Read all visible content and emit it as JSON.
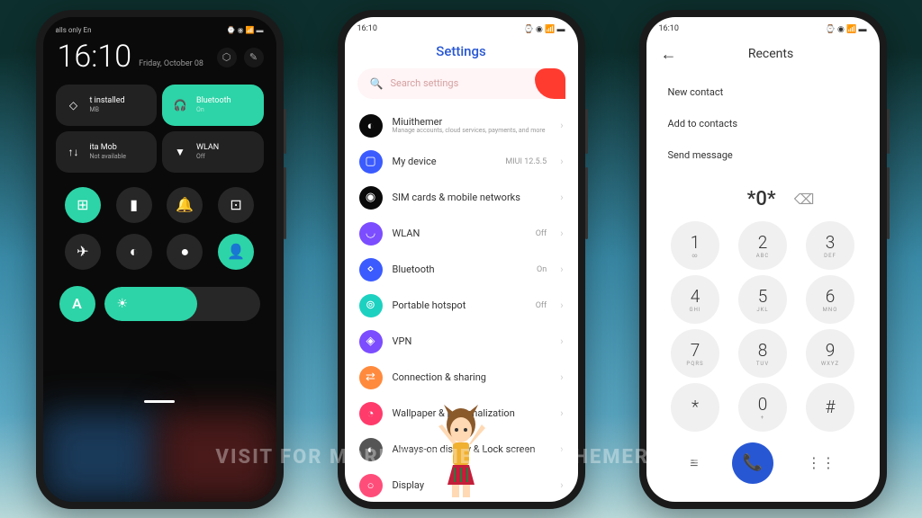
{
  "watermark": "VISIT FOR MORE THEMES - MIUITHEMER.COM",
  "p1": {
    "status_left": "alls only     En",
    "status_right": "⌚ ◉ 📶 ▬",
    "time": "16:10",
    "date": "Friday, October 08",
    "tiles": [
      {
        "title": "t installed",
        "sub": "MB",
        "icon": "◇",
        "on": false
      },
      {
        "title": "Bluetooth",
        "sub": "On",
        "icon": "🎧",
        "on": true
      },
      {
        "title": "ita    Mob",
        "sub": "Not available",
        "icon": "↑↓",
        "on": false
      },
      {
        "title": "WLAN",
        "sub": "Off",
        "icon": "▼",
        "on": false
      }
    ],
    "circles": [
      {
        "icon": "⊞",
        "on": true
      },
      {
        "icon": "▮",
        "on": false
      },
      {
        "icon": "🔔",
        "on": false
      },
      {
        "icon": "⊡",
        "on": false
      },
      {
        "icon": "✈",
        "on": false
      },
      {
        "icon": "◐",
        "on": false
      },
      {
        "icon": "●",
        "on": false
      },
      {
        "icon": "👤",
        "on": true
      }
    ],
    "auto_label": "A",
    "brightness_icon": "☀"
  },
  "p2": {
    "status_time": "16:10",
    "status_right": "⌚ ◉ 📶 ▬",
    "title": "Settings",
    "search_placeholder": "Search settings",
    "items": [
      {
        "label": "Miuithemer",
        "sub": "Manage accounts, cloud services, payments, and more",
        "val": "",
        "cls": "ic-dark",
        "icon": "◐"
      },
      {
        "label": "My device",
        "sub": "",
        "val": "MIUI 12.5.5",
        "cls": "ic-blue",
        "icon": "▢"
      },
      {
        "label": "SIM cards & mobile networks",
        "sub": "",
        "val": "",
        "cls": "ic-dark",
        "icon": "◉"
      },
      {
        "label": "WLAN",
        "sub": "",
        "val": "Off",
        "cls": "ic-purple",
        "icon": "◡"
      },
      {
        "label": "Bluetooth",
        "sub": "",
        "val": "On",
        "cls": "ic-blue",
        "icon": "⋄"
      },
      {
        "label": "Portable hotspot",
        "sub": "",
        "val": "Off",
        "cls": "ic-cyan",
        "icon": "⊚"
      },
      {
        "label": "VPN",
        "sub": "",
        "val": "",
        "cls": "ic-purple",
        "icon": "◈"
      },
      {
        "label": "Connection & sharing",
        "sub": "",
        "val": "",
        "cls": "ic-orange",
        "icon": "⇄"
      },
      {
        "label": "Wallpaper & personalization",
        "sub": "",
        "val": "",
        "cls": "ic-red",
        "icon": "◔"
      },
      {
        "label": "Always-on display & Lock screen",
        "sub": "",
        "val": "",
        "cls": "ic-gray",
        "icon": "◐"
      },
      {
        "label": "Display",
        "sub": "",
        "val": "",
        "cls": "ic-pink",
        "icon": "○"
      }
    ]
  },
  "p3": {
    "status_time": "16:10",
    "status_right": "⌚ ◉ 📶 ▬",
    "title": "Recents",
    "back": "←",
    "actions": [
      "New contact",
      "Add to contacts",
      "Send message"
    ],
    "number": "*0*",
    "del_icon": "⌫",
    "keys": [
      {
        "n": "1",
        "l": "∞"
      },
      {
        "n": "2",
        "l": "ABC"
      },
      {
        "n": "3",
        "l": "DEF"
      },
      {
        "n": "4",
        "l": "GHI"
      },
      {
        "n": "5",
        "l": "JKL"
      },
      {
        "n": "6",
        "l": "MNO"
      },
      {
        "n": "7",
        "l": "PQRS"
      },
      {
        "n": "8",
        "l": "TUV"
      },
      {
        "n": "9",
        "l": "WXYZ"
      },
      {
        "n": "*",
        "l": ""
      },
      {
        "n": "0",
        "l": "+"
      },
      {
        "n": "#",
        "l": ""
      }
    ],
    "menu_icon": "≡",
    "call_icon": "📞",
    "grid_icon": "⋮⋮"
  }
}
